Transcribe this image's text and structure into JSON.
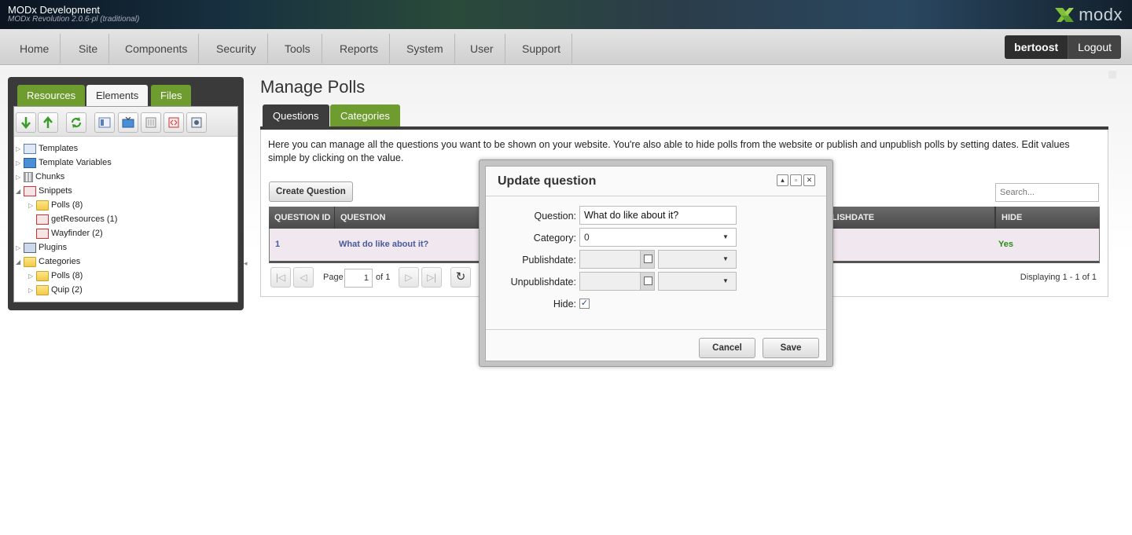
{
  "header": {
    "site_name": "MODx Development",
    "site_version": "MODx Revolution 2.0.6-pl (traditional)",
    "logo_text": "modx"
  },
  "nav": {
    "items": [
      "Home",
      "Site",
      "Components",
      "Security",
      "Tools",
      "Reports",
      "System",
      "User",
      "Support"
    ],
    "username": "bertoost",
    "logout": "Logout"
  },
  "left_panel": {
    "tabs": [
      "Resources",
      "Elements",
      "Files"
    ],
    "active_tab": "Elements",
    "toolbar_icons": [
      "arrow-down-icon",
      "arrow-up-icon",
      "refresh-icon",
      "new-template-icon",
      "new-tv-icon",
      "new-chunk-icon",
      "new-snippet-icon",
      "new-plugin-icon"
    ],
    "tree": [
      {
        "label": "Templates",
        "icon": "template-icon",
        "depth": 0,
        "expanded": false
      },
      {
        "label": "Template Variables",
        "icon": "tv-icon",
        "depth": 0,
        "expanded": false
      },
      {
        "label": "Chunks",
        "icon": "chunk-icon",
        "depth": 0,
        "expanded": false
      },
      {
        "label": "Snippets",
        "icon": "snippet-icon",
        "depth": 0,
        "expanded": true
      },
      {
        "label": "Polls (8)",
        "icon": "folder-icon",
        "depth": 1,
        "expanded": false
      },
      {
        "label": "getResources (1)",
        "icon": "snippet-icon",
        "depth": 1,
        "leaf": true
      },
      {
        "label": "Wayfinder (2)",
        "icon": "snippet-icon",
        "depth": 1,
        "leaf": true
      },
      {
        "label": "Plugins",
        "icon": "plugin-icon",
        "depth": 0,
        "expanded": false
      },
      {
        "label": "Categories",
        "icon": "folder-icon",
        "depth": 0,
        "expanded": true
      },
      {
        "label": "Polls (8)",
        "icon": "folder-icon",
        "depth": 1,
        "expanded": false
      },
      {
        "label": "Quip (2)",
        "icon": "folder-icon",
        "depth": 1,
        "expanded": false
      }
    ]
  },
  "main": {
    "title": "Manage Polls",
    "tabs": [
      "Questions",
      "Categories"
    ],
    "description": "Here you can manage all the questions you want to be shown on your website. You're also able to hide polls from the website or publish and unpublish polls by setting dates. Edit values simple by clicking on the value.",
    "create_button": "Create Question",
    "search_placeholder": "Search...",
    "columns": {
      "id": "QUESTION ID",
      "question": "QUESTION",
      "publishdate_partial": "BLISHDATE",
      "hide": "HIDE"
    },
    "rows": [
      {
        "id": "1",
        "question": "What do like about it?",
        "hide": "Yes"
      }
    ],
    "pager": {
      "page_label": "Page",
      "page_value": "1",
      "of": "of 1",
      "partial": "P",
      "display": "Displaying 1 - 1 of 1"
    }
  },
  "modal": {
    "title": "Update question",
    "fields": {
      "question_label": "Question:",
      "question_value": "What do like about it?",
      "category_label": "Category:",
      "category_value": "0",
      "publishdate_label": "Publishdate:",
      "unpublishdate_label": "Unpublishdate:",
      "hide_label": "Hide:",
      "hide_checked": true
    },
    "cancel": "Cancel",
    "save": "Save"
  },
  "colors": {
    "green_tab": "#6e9c2f",
    "dark_tab": "#3d3d3d",
    "row_highlight": "#f0e8ee",
    "link_blue": "#4a5a9a",
    "yes_green": "#2a8a1a"
  }
}
